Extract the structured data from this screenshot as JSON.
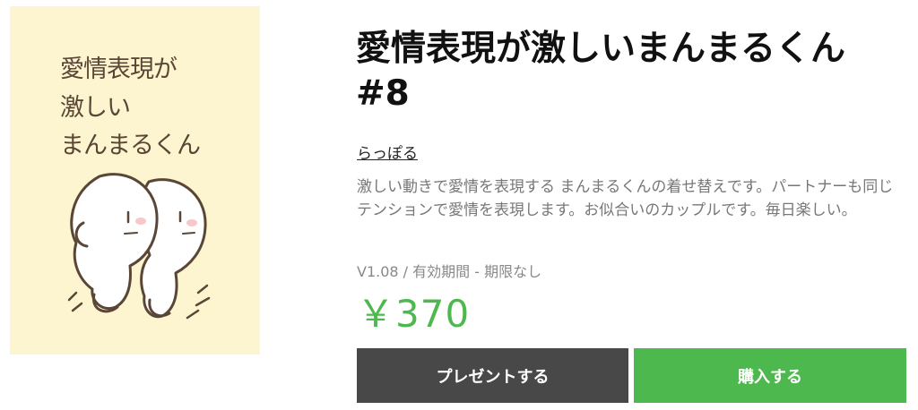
{
  "thumbnail": {
    "title_lines": [
      "愛情表現が",
      "激しい",
      "まんまるくん"
    ],
    "background": "#fdf5cf"
  },
  "product": {
    "title": "愛情表現が激しいまんまるくん #8",
    "author": "らっぽる",
    "description": "激しい動きで愛情を表現する まんまるくんの着せ替えです。パートナーも同じテンションで愛情を表現します。お似合いのカップルです。毎日楽しい。",
    "version_info": "V1.08 / 有効期間 - 期限なし",
    "price": "￥370"
  },
  "actions": {
    "present_label": "プレゼントする",
    "buy_label": "購入する"
  },
  "colors": {
    "accent_green": "#4db84d",
    "present_button": "#484848"
  }
}
